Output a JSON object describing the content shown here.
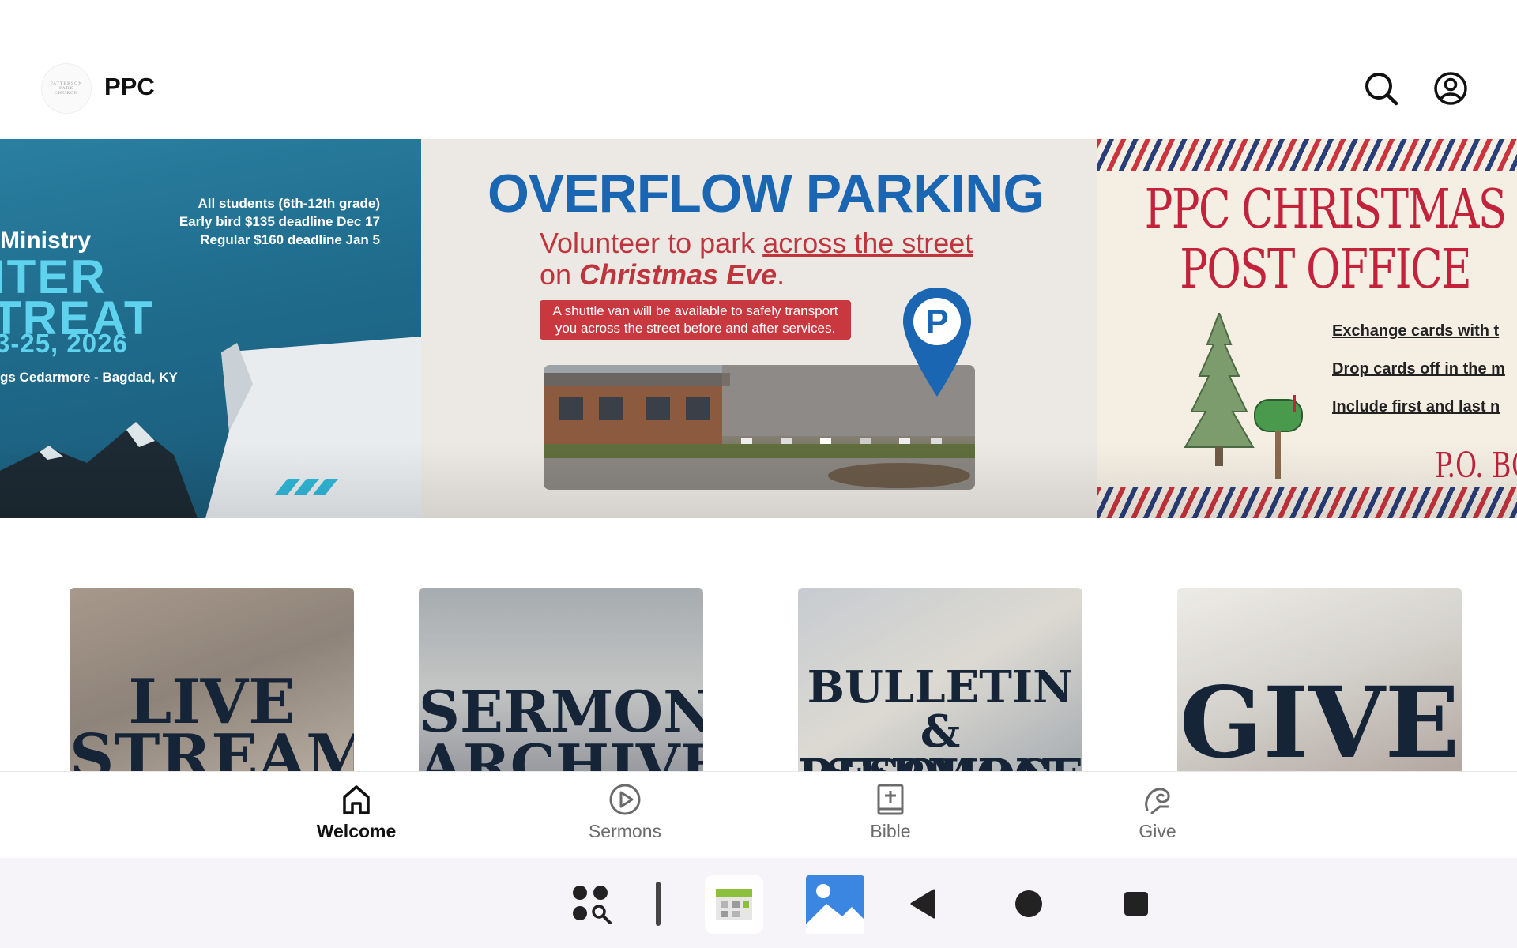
{
  "header": {
    "logo_text": [
      "PATTERSON",
      "PARK",
      "CHURCH"
    ],
    "title": "PPC",
    "search_icon": "search-icon",
    "account_icon": "account-circle-icon"
  },
  "carousel": {
    "active_index": 0,
    "dot_count": 5,
    "slides": [
      {
        "id": "winter-retreat",
        "details": [
          "All students (6th-12th grade)",
          "Early bird $135 deadline Dec 17",
          "Regular $160 deadline Jan 5"
        ],
        "ministry": "Ministry",
        "title_lines": [
          "ITER",
          "TREAT"
        ],
        "dates": "3-25, 2026",
        "location": "gs Cedarmore - Bagdad, KY"
      },
      {
        "id": "overflow-parking",
        "title": "OVERFLOW PARKING",
        "line1_prefix": "Volunteer to park ",
        "line1_link": "across the street",
        "line2_prefix": "on ",
        "line2_emphasis": "Christmas Eve",
        "line2_suffix": ".",
        "note_line1": "A shuttle van will be available to safely transport",
        "note_line2": "you across the street before and after services.",
        "pin_letter": "P"
      },
      {
        "id": "christmas-post-office",
        "title_line1": "PPC CHRISTMAS",
        "title_line2": "POST OFFICE",
        "lines": [
          "Exchange cards with t",
          "Drop cards off in the m",
          "Include first and last n"
        ],
        "po": "P.O. BO"
      }
    ]
  },
  "tiles": [
    {
      "id": "live-stream",
      "lines": [
        "LIVE",
        "STREAM"
      ]
    },
    {
      "id": "sermon-archive",
      "lines": [
        "SERMON",
        "ARCHIVE"
      ]
    },
    {
      "id": "bulletin",
      "lines": [
        "BULLETIN",
        "& SERMON",
        "RESOURCES"
      ]
    },
    {
      "id": "give",
      "lines": [
        "GIVE"
      ]
    }
  ],
  "bottom_nav": {
    "items": [
      {
        "label": "Welcome",
        "icon": "home-icon",
        "active": true
      },
      {
        "label": "Sermons",
        "icon": "play-circle-icon",
        "active": false
      },
      {
        "label": "Bible",
        "icon": "bible-icon",
        "active": false
      },
      {
        "label": "Give",
        "icon": "give-icon",
        "active": false
      }
    ]
  },
  "system_bar": {
    "icons": [
      "app-drawer-icon",
      "calendar-app-icon",
      "gallery-app-icon",
      "back-icon",
      "home-button-icon",
      "recents-icon"
    ]
  },
  "colors": {
    "accent_blue": "#1a66b3",
    "accent_red": "#c2233b",
    "retreat_cyan": "#5fd3ee",
    "tile_text": "#162437"
  }
}
